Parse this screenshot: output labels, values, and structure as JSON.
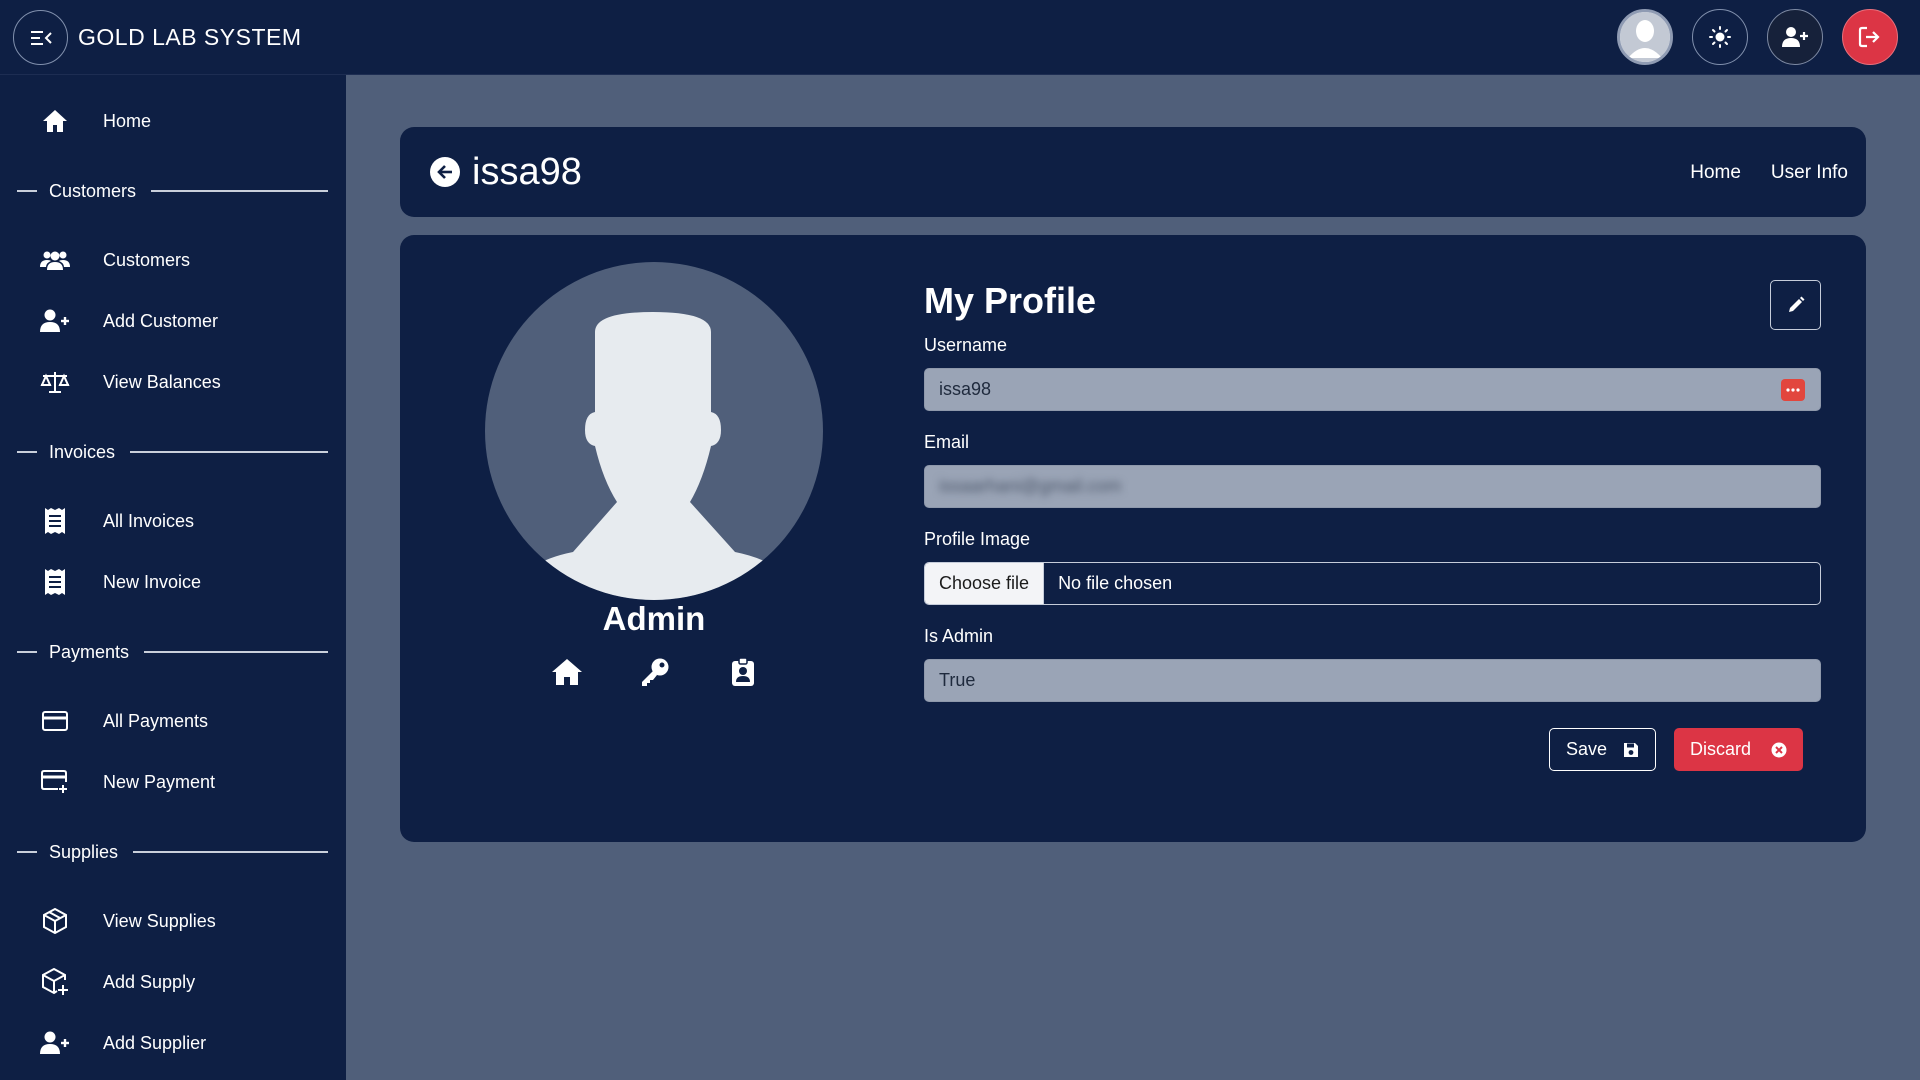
{
  "app": {
    "title": "GOLD LAB SYSTEM"
  },
  "topbar": {
    "icons": [
      "menu-collapse-icon",
      "user-avatar",
      "sun-icon",
      "user-plus-icon",
      "logout-icon"
    ]
  },
  "sidebar": {
    "home_label": "Home",
    "sections": {
      "customers": {
        "title": "Customers",
        "items": [
          "Customers",
          "Add Customer",
          "View Balances"
        ]
      },
      "invoices": {
        "title": "Invoices",
        "items": [
          "All Invoices",
          "New Invoice"
        ]
      },
      "payments": {
        "title": "Payments",
        "items": [
          "All Payments",
          "New Payment"
        ]
      },
      "supplies": {
        "title": "Supplies",
        "items": [
          "View Supplies",
          "Add Supply",
          "Add Supplier"
        ]
      }
    }
  },
  "header": {
    "title": "issa98",
    "breadcrumbs": [
      "Home",
      "User Info"
    ]
  },
  "profile": {
    "role": "Admin",
    "form_title": "My Profile",
    "fields": {
      "username": {
        "label": "Username",
        "value": "issa98"
      },
      "email": {
        "label": "Email",
        "value": "issaarhani@gmail.com"
      },
      "profile_image": {
        "label": "Profile Image",
        "button": "Choose file",
        "status": "No file chosen"
      },
      "is_admin": {
        "label": "Is Admin",
        "value": "True"
      }
    },
    "save_label": "Save",
    "discard_label": "Discard"
  },
  "colors": {
    "navy": "#0e1f44",
    "slate": "#505f7a",
    "danger": "#dc3545",
    "input_bg": "#9aa4b6"
  }
}
